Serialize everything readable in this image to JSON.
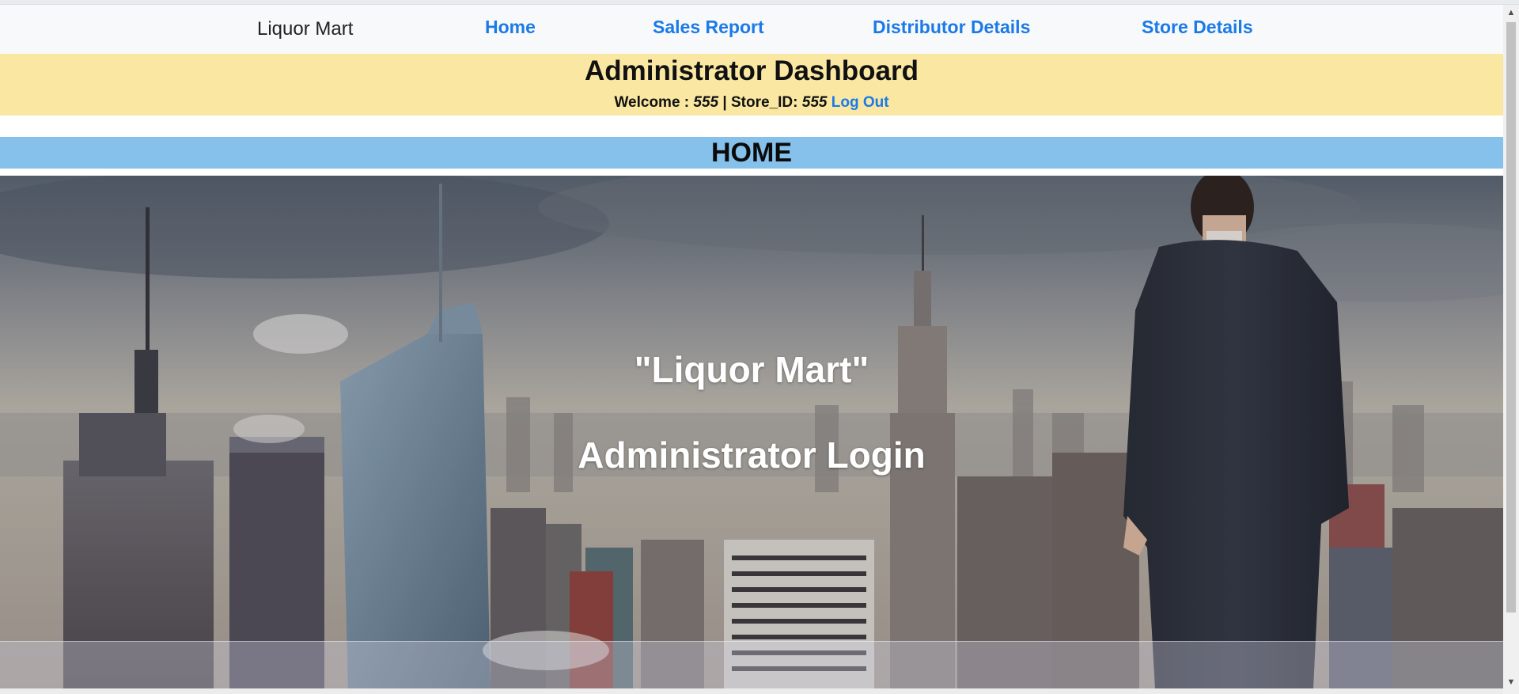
{
  "navbar": {
    "brand": "Liquor Mart",
    "links": {
      "home": "Home",
      "sales_report": "Sales Report",
      "distributor_details": "Distributor Details",
      "store_details": "Store Details"
    }
  },
  "dashboard": {
    "title": "Administrator Dashboard",
    "welcome_label": "Welcome : ",
    "user": "555",
    "separator": " | Store_ID: ",
    "store_id": "555",
    "logout": "Log Out"
  },
  "section": {
    "title": "HOME"
  },
  "hero": {
    "title": "\"Liquor Mart\"",
    "subtitle": "Administrator Login"
  },
  "scrollbar": {
    "up_icon": "triangle-up-icon",
    "down_icon": "triangle-down-icon"
  },
  "colors": {
    "nav_background": "#f8f9fa",
    "link": "#1a7ae8",
    "dashboard_background": "#f9e7a2",
    "home_bar_background": "#85c1ea"
  }
}
